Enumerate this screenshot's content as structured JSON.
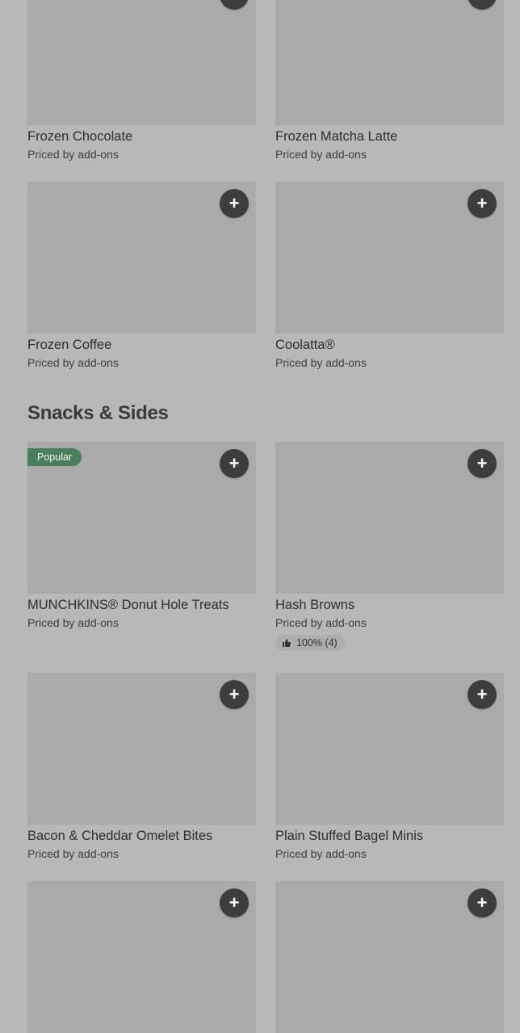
{
  "items_top": [
    {
      "name": "Frozen Chocolate",
      "price": "Priced by add-ons"
    },
    {
      "name": "Frozen Matcha Latte",
      "price": "Priced by add-ons"
    },
    {
      "name": "Frozen Coffee",
      "price": "Priced by add-ons"
    },
    {
      "name": "Coolatta®",
      "price": "Priced by add-ons"
    }
  ],
  "section": {
    "title": "Snacks & Sides"
  },
  "items_snacks": [
    {
      "name": "MUNCHKINS® Donut Hole Treats",
      "price": "Priced by add-ons",
      "badge": "Popular"
    },
    {
      "name": "Hash Browns",
      "price": "Priced by add-ons",
      "rating": "100% (4)"
    },
    {
      "name": "Bacon & Cheddar Omelet Bites",
      "price": "Priced by add-ons"
    },
    {
      "name": "Plain Stuffed Bagel Minis",
      "price": "Priced by add-ons"
    }
  ],
  "add_button_symbol": "+",
  "icons": {
    "add": "plus-icon",
    "rating": "thumbs-up-icon"
  },
  "colors": {
    "background": "#b8b8b8",
    "image_placeholder": "#aaaaaa",
    "add_button": "#3d3d3d",
    "popular_badge": "#4a7f5c"
  }
}
